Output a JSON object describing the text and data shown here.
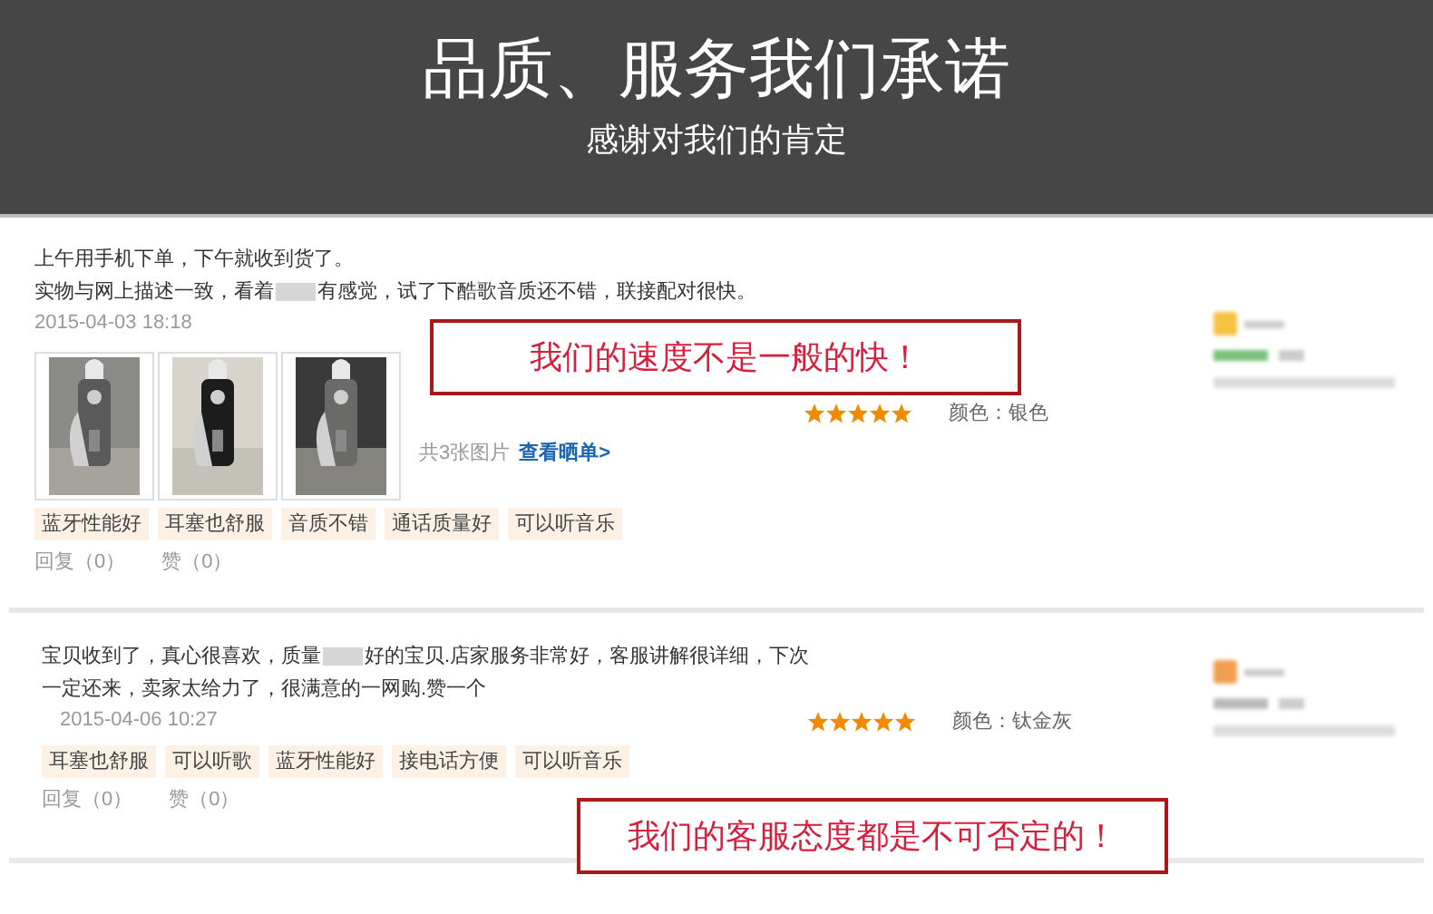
{
  "header": {
    "title": "品质、服务我们承诺",
    "subtitle": "感谢对我们的肯定"
  },
  "reviews": [
    {
      "paragraphs": [
        {
          "segments": [
            "上午用手机下单，下午就收到货了。"
          ]
        },
        {
          "segments": [
            "实物与网上描述一致，看着",
            "有感觉，试了下酷歌音质还不错，联接配对很快。"
          ]
        }
      ],
      "date": "2015-04-03 18:18",
      "photos": [
        {
          "kind": "picture"
        },
        {
          "kind": "picture"
        },
        {
          "kind": "picture"
        }
      ],
      "photo_count": "共3张图片",
      "view_link": "查看晒单>",
      "stars": 5,
      "variant": "颜色：银色",
      "tags": [
        "蓝牙性能好",
        "耳塞也舒服",
        "音质不错",
        "通话质量好",
        "可以听音乐"
      ],
      "reply": "回复（0）",
      "like": "赞（0）"
    },
    {
      "paragraphs": [
        {
          "segments": [
            "宝贝收到了，真心很喜欢，质量",
            "好的宝贝.店家服务非常好，客服讲解很详细，下次一定还来，卖家太给力了，很满意的一网购.赞一个"
          ]
        }
      ],
      "date": "2015-04-06 10:27",
      "stars": 5,
      "variant": "颜色：钛金灰",
      "tags": [
        "耳塞也舒服",
        "可以听歌",
        "蓝牙性能好",
        "接电话方便",
        "可以听音乐"
      ],
      "reply": "回复（0）",
      "like": "赞（0）"
    }
  ],
  "overlays": [
    {
      "text": "我们的速度不是一般的快！"
    },
    {
      "text": "我们的客服态度都是不可否定的！"
    }
  ]
}
